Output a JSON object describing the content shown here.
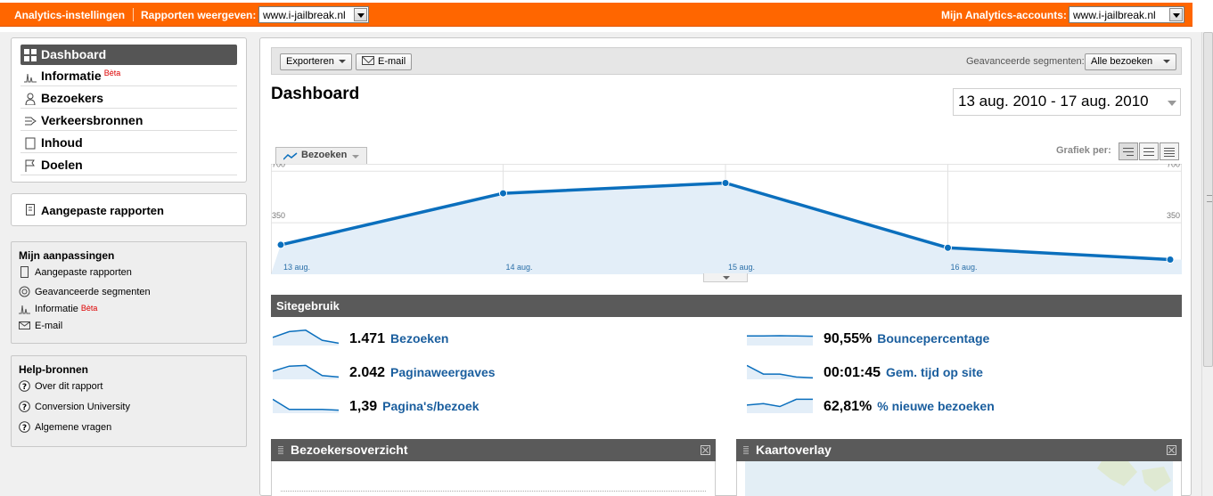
{
  "topbar": {
    "settings_link": "Analytics-instellingen",
    "reports_label": "Rapporten weergeven:",
    "reports_value": "www.i-jailbreak.nl",
    "accounts_label": "Mijn Analytics-accounts:",
    "accounts_value": "www.i-jailbreak.nl",
    "accent_color": "#ff6600"
  },
  "sidebar": {
    "nav": [
      {
        "label": "Dashboard",
        "icon": "dashboard-icon",
        "active": true
      },
      {
        "label": "Informatie",
        "icon": "intelligence-icon",
        "badge": "Bèta"
      },
      {
        "label": "Bezoekers",
        "icon": "visitor-icon"
      },
      {
        "label": "Verkeersbronnen",
        "icon": "traffic-sources-icon"
      },
      {
        "label": "Inhoud",
        "icon": "content-icon"
      },
      {
        "label": "Doelen",
        "icon": "goal-flag-icon"
      }
    ],
    "custom_reports": "Aangepaste rapporten",
    "customizations": {
      "title": "Mijn aanpassingen",
      "items": [
        {
          "label": "Aangepaste rapporten",
          "icon": "report-icon"
        },
        {
          "label": "Geavanceerde segmenten",
          "icon": "segments-icon"
        },
        {
          "label": "Informatie",
          "icon": "intelligence-icon",
          "badge": "Bèta"
        },
        {
          "label": "E-mail",
          "icon": "mail-icon"
        }
      ]
    },
    "help": {
      "title": "Help-bronnen",
      "items": [
        {
          "label": "Over dit rapport",
          "icon": "help-icon"
        },
        {
          "label": "Conversion University",
          "icon": "help-icon"
        },
        {
          "label": "Algemene vragen",
          "icon": "help-icon"
        }
      ]
    }
  },
  "toolbar": {
    "export_label": "Exporteren",
    "email_label": "E-mail",
    "segments_label": "Geavanceerde segmenten:",
    "segments_value": "Alle bezoeken"
  },
  "page": {
    "title": "Dashboard",
    "date_range": "13 aug. 2010 - 17 aug. 2010",
    "metric_selector": "Bezoeken",
    "graph_per_label": "Grafiek per:"
  },
  "chart_data": {
    "type": "line",
    "x": [
      "13 aug.",
      "14 aug.",
      "15 aug.",
      "16 aug.",
      "17 aug."
    ],
    "x_tick_labels": [
      "13 aug.",
      "14 aug.",
      "15 aug.",
      "16 aug."
    ],
    "series": [
      {
        "name": "Bezoeken",
        "values": [
          200,
          550,
          620,
          180,
          100
        ]
      }
    ],
    "ylim": [
      0,
      750
    ],
    "y_ticks_left": [
      "700",
      "350"
    ],
    "y_ticks_right": [
      "700",
      "350"
    ],
    "y_tick_values": [
      700,
      350
    ],
    "line_color": "#0b6fbd",
    "fill_color": "#e3eef8",
    "grid": true
  },
  "site_usage": {
    "title": "Sitegebruik",
    "metrics": [
      {
        "value": "1.471",
        "label": "Bezoeken",
        "spark": [
          0.5,
          0.9,
          1.0,
          0.3,
          0.1
        ]
      },
      {
        "value": "90,55%",
        "label": "Bouncepercentage",
        "spark": [
          0.6,
          0.6,
          0.62,
          0.6,
          0.58
        ]
      },
      {
        "value": "2.042",
        "label": "Paginaweergaves",
        "spark": [
          0.5,
          0.85,
          0.9,
          0.2,
          0.1
        ]
      },
      {
        "value": "00:01:45",
        "label": "Gem. tijd op site",
        "spark": [
          0.9,
          0.3,
          0.3,
          0.1,
          0.05
        ]
      },
      {
        "value": "1,39",
        "label": "Pagina's/bezoek",
        "spark": [
          0.9,
          0.2,
          0.2,
          0.2,
          0.15
        ]
      },
      {
        "value": "62,81%",
        "label": "% nieuwe bezoeken",
        "spark": [
          0.5,
          0.6,
          0.4,
          0.9,
          0.9
        ]
      }
    ]
  },
  "widgets": {
    "visitors_overview": "Bezoekersoverzicht",
    "map_overlay": "Kaartoverlay"
  }
}
